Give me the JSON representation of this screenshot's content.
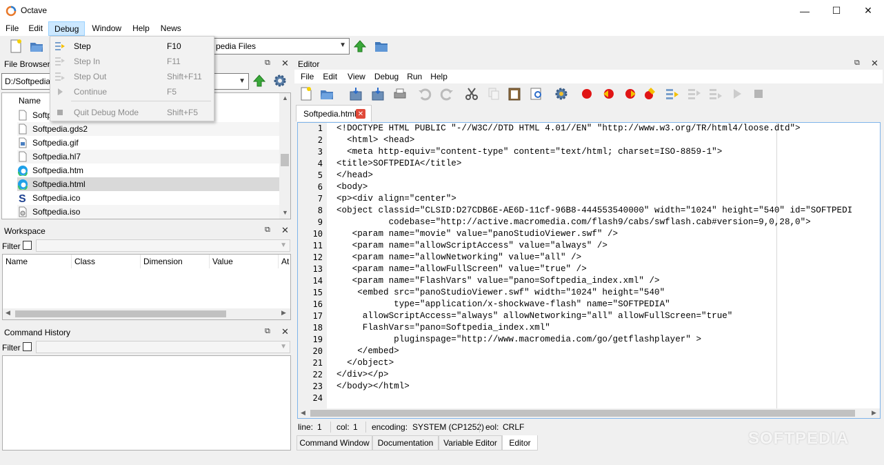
{
  "window": {
    "title": "Octave",
    "minimize": "—",
    "maximize": "☐",
    "close": "✕"
  },
  "menubar": [
    "File",
    "Edit",
    "Debug",
    "Window",
    "Help",
    "News"
  ],
  "toolbar": {
    "current_dir": "pedia Files"
  },
  "debug_menu": [
    {
      "label": "Step",
      "key": "F10",
      "enabled": true
    },
    {
      "label": "Step In",
      "key": "F11",
      "enabled": false
    },
    {
      "label": "Step Out",
      "key": "Shift+F11",
      "enabled": false
    },
    {
      "label": "Continue",
      "key": "F5",
      "enabled": false
    },
    {
      "label": "Quit Debug Mode",
      "key": "Shift+F5",
      "enabled": false
    }
  ],
  "file_browser": {
    "title": "File Browser",
    "path": "D:/Softpedia",
    "column": "Name",
    "files": [
      "Softp",
      "Softpedia.gds2",
      "Softpedia.gif",
      "Softpedia.hl7",
      "Softpedia.htm",
      "Softpedia.html",
      "Softpedia.ico",
      "Softpedia.iso"
    ],
    "selected": "Softpedia.html"
  },
  "workspace": {
    "title": "Workspace",
    "filter_label": "Filter",
    "columns": [
      "Name",
      "Class",
      "Dimension",
      "Value",
      "At"
    ]
  },
  "command_history": {
    "title": "Command History",
    "filter_label": "Filter"
  },
  "editor": {
    "title": "Editor",
    "menu": [
      "File",
      "Edit",
      "View",
      "Debug",
      "Run",
      "Help"
    ],
    "tab": "Softpedia.html",
    "lines": [
      "<!DOCTYPE HTML PUBLIC \"-//W3C//DTD HTML 4.01//EN\" \"http://www.w3.org/TR/html4/loose.dtd\">",
      "  <html> <head>",
      "  <meta http-equiv=\"content-type\" content=\"text/html; charset=ISO-8859-1\">",
      "<title>SOFTPEDIA</title>",
      "</head>",
      "<body>",
      "<p><div align=\"center\">",
      "<object classid=\"CLSID:D27CDB6E-AE6D-11cf-96B8-444553540000\" width=\"1024\" height=\"540\" id=\"SOFTPEDI",
      "          codebase=\"http://active.macromedia.com/flash9/cabs/swflash.cab#version=9,0,28,0\">",
      "   <param name=\"movie\" value=\"panoStudioViewer.swf\" />",
      "   <param name=\"allowScriptAccess\" value=\"always\" />",
      "   <param name=\"allowNetworking\" value=\"all\" />",
      "   <param name=\"allowFullScreen\" value=\"true\" />",
      "   <param name=\"FlashVars\" value=\"pano=Softpedia_index.xml\" />",
      "    <embed src=\"panoStudioViewer.swf\" width=\"1024\" height=\"540\"",
      "           type=\"application/x-shockwave-flash\" name=\"SOFTPEDIA\"",
      "     allowScriptAccess=\"always\" allowNetworking=\"all\" allowFullScreen=\"true\"",
      "     FlashVars=\"pano=Softpedia_index.xml\"",
      "           pluginspage=\"http://www.macromedia.com/go/getflashplayer\" >",
      "    </embed>",
      "  </object>",
      "</div></p>",
      "</body></html>",
      ""
    ],
    "status": {
      "line_label": "line:",
      "line": "1",
      "col_label": "col:",
      "col": "1",
      "encoding_label": "encoding:",
      "encoding": "SYSTEM (CP1252)",
      "eol_label": "eol:",
      "eol": "CRLF"
    }
  },
  "bottom_tabs": [
    "Command Window",
    "Documentation",
    "Variable Editor",
    "Editor"
  ],
  "active_bottom_tab": "Editor",
  "watermark": "SOFTPEDIA"
}
